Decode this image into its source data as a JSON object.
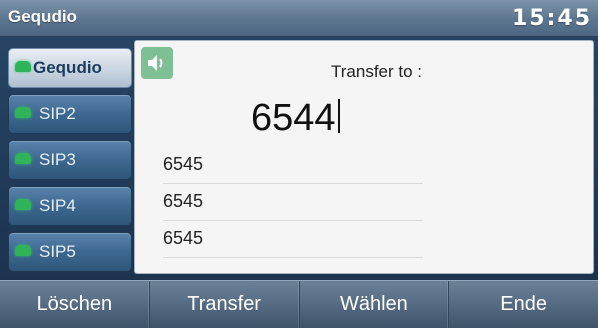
{
  "titlebar": {
    "title": "Gequdio",
    "clock": "15:45"
  },
  "line_keys": [
    {
      "label": "Gequdio",
      "active": true
    },
    {
      "label": "SIP2"
    },
    {
      "label": "SIP3"
    },
    {
      "label": "SIP4"
    },
    {
      "label": "SIP5"
    }
  ],
  "main": {
    "speaker_icon": "speaker-icon",
    "transfer_label": "Transfer to :",
    "input_value": "6544",
    "history": [
      "6545",
      "6545",
      "6545"
    ]
  },
  "softkeys": [
    "Löschen",
    "Transfer",
    "Wählen",
    "Ende"
  ],
  "colors": {
    "accent_green": "#2fb45a",
    "panel_bg": "#f4f5f4",
    "titlebar": "#5f7891"
  }
}
